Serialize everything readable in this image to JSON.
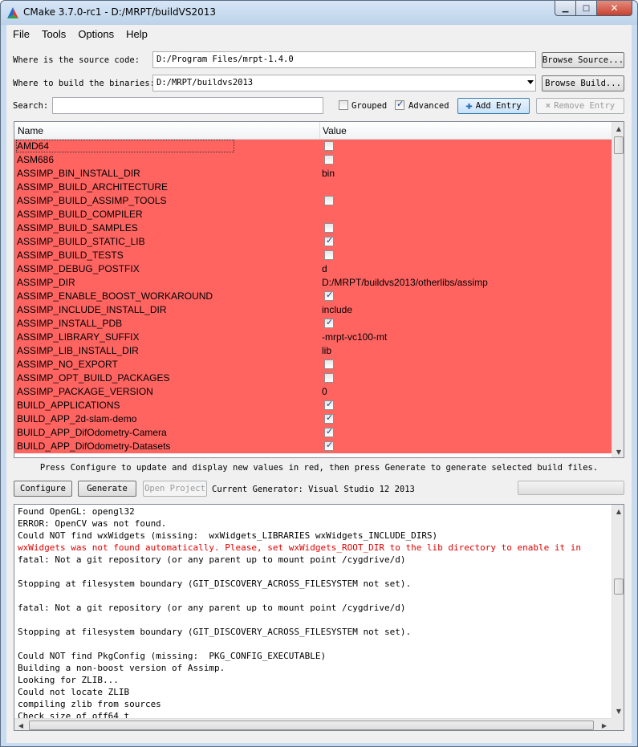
{
  "window": {
    "title": "CMake 3.7.0-rc1 - D:/MRPT/buildVS2013"
  },
  "menu": [
    "File",
    "Tools",
    "Options",
    "Help"
  ],
  "source": {
    "label": "Where is the source code:",
    "value": "D:/Program Files/mrpt-1.4.0",
    "browse_label": "Browse Source..."
  },
  "build": {
    "label": "Where to build the binaries:",
    "value": "D:/MRPT/buildvs2013",
    "browse_label": "Browse Build..."
  },
  "search": {
    "label": "Search:",
    "value": ""
  },
  "options": {
    "grouped_label": "Grouped",
    "grouped_checked": false,
    "advanced_label": "Advanced",
    "advanced_checked": true
  },
  "toolbar": {
    "add_entry": "Add Entry",
    "remove_entry": "Remove Entry"
  },
  "table": {
    "headers": {
      "name": "Name",
      "value": "Value"
    },
    "rows": [
      {
        "name": "AMD64",
        "type": "bool",
        "value": false
      },
      {
        "name": "ASM686",
        "type": "bool",
        "value": false
      },
      {
        "name": "ASSIMP_BIN_INSTALL_DIR",
        "type": "text",
        "value": "bin"
      },
      {
        "name": "ASSIMP_BUILD_ARCHITECTURE",
        "type": "text",
        "value": ""
      },
      {
        "name": "ASSIMP_BUILD_ASSIMP_TOOLS",
        "type": "bool",
        "value": false
      },
      {
        "name": "ASSIMP_BUILD_COMPILER",
        "type": "text",
        "value": ""
      },
      {
        "name": "ASSIMP_BUILD_SAMPLES",
        "type": "bool",
        "value": false
      },
      {
        "name": "ASSIMP_BUILD_STATIC_LIB",
        "type": "bool",
        "value": true
      },
      {
        "name": "ASSIMP_BUILD_TESTS",
        "type": "bool",
        "value": false
      },
      {
        "name": "ASSIMP_DEBUG_POSTFIX",
        "type": "text",
        "value": "d"
      },
      {
        "name": "ASSIMP_DIR",
        "type": "text",
        "value": "D:/MRPT/buildvs2013/otherlibs/assimp"
      },
      {
        "name": "ASSIMP_ENABLE_BOOST_WORKAROUND",
        "type": "bool",
        "value": true
      },
      {
        "name": "ASSIMP_INCLUDE_INSTALL_DIR",
        "type": "text",
        "value": "include"
      },
      {
        "name": "ASSIMP_INSTALL_PDB",
        "type": "bool",
        "value": true
      },
      {
        "name": "ASSIMP_LIBRARY_SUFFIX",
        "type": "text",
        "value": "-mrpt-vc100-mt"
      },
      {
        "name": "ASSIMP_LIB_INSTALL_DIR",
        "type": "text",
        "value": "lib"
      },
      {
        "name": "ASSIMP_NO_EXPORT",
        "type": "bool",
        "value": false
      },
      {
        "name": "ASSIMP_OPT_BUILD_PACKAGES",
        "type": "bool",
        "value": false
      },
      {
        "name": "ASSIMP_PACKAGE_VERSION",
        "type": "text",
        "value": "0"
      },
      {
        "name": "BUILD_APPLICATIONS",
        "type": "bool",
        "value": true
      },
      {
        "name": "BUILD_APP_2d-slam-demo",
        "type": "bool",
        "value": true
      },
      {
        "name": "BUILD_APP_DifOdometry-Camera",
        "type": "bool",
        "value": true
      },
      {
        "name": "BUILD_APP_DifOdometry-Datasets",
        "type": "bool",
        "value": true
      }
    ]
  },
  "hint": "Press Configure to update and display new values in red, then press Generate to generate selected build files.",
  "actions": {
    "configure": "Configure",
    "generate": "Generate",
    "open_project": "Open Project"
  },
  "generator": "Current Generator: Visual Studio 12 2013",
  "output_lines": [
    {
      "text": "Found OpenGL: opengl32",
      "error": false
    },
    {
      "text": "ERROR: OpenCV was not found.",
      "error": false
    },
    {
      "text": "Could NOT find wxWidgets (missing:  wxWidgets_LIBRARIES wxWidgets_INCLUDE_DIRS)",
      "error": false
    },
    {
      "text": "wxWidgets was not found automatically. Please, set wxWidgets_ROOT_DIR to the lib directory to enable it in",
      "error": true
    },
    {
      "text": "fatal: Not a git repository (or any parent up to mount point /cygdrive/d)",
      "error": false
    },
    {
      "text": "",
      "error": false
    },
    {
      "text": "Stopping at filesystem boundary (GIT_DISCOVERY_ACROSS_FILESYSTEM not set).",
      "error": false
    },
    {
      "text": "",
      "error": false
    },
    {
      "text": "fatal: Not a git repository (or any parent up to mount point /cygdrive/d)",
      "error": false
    },
    {
      "text": "",
      "error": false
    },
    {
      "text": "Stopping at filesystem boundary (GIT_DISCOVERY_ACROSS_FILESYSTEM not set).",
      "error": false
    },
    {
      "text": "",
      "error": false
    },
    {
      "text": "Could NOT find PkgConfig (missing:  PKG_CONFIG_EXECUTABLE)",
      "error": false
    },
    {
      "text": "Building a non-boost version of Assimp.",
      "error": false
    },
    {
      "text": "Looking for ZLIB...",
      "error": false
    },
    {
      "text": "Could not locate ZLIB",
      "error": false
    },
    {
      "text": "compiling zlib from sources",
      "error": false
    },
    {
      "text": "Check size of off64_t",
      "error": false
    }
  ]
}
